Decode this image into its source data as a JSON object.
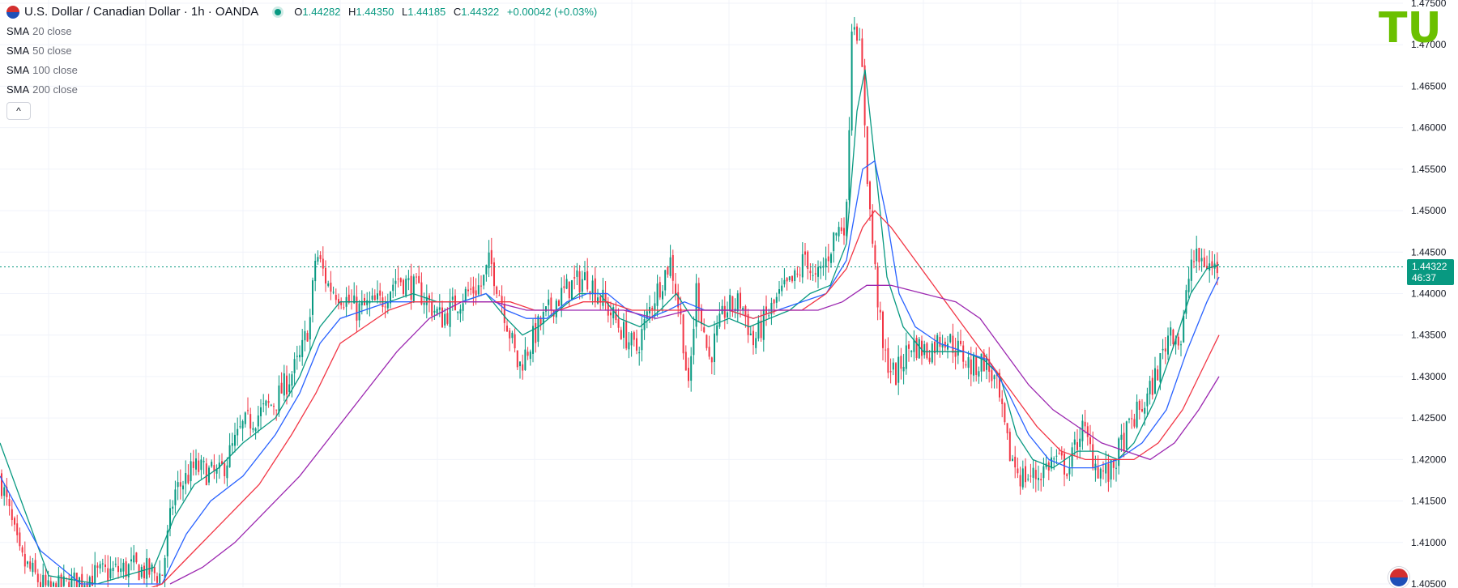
{
  "header": {
    "symbol_title": "U.S. Dollar / Canadian Dollar · 1h · OANDA",
    "ohlc": {
      "o_label": "O",
      "o_value": "1.44282",
      "h_label": "H",
      "h_value": "1.44350",
      "l_label": "L",
      "l_value": "1.44185",
      "c_label": "C",
      "c_value": "1.44322",
      "change": "+0.00042 (+0.03%)"
    }
  },
  "indicators": [
    {
      "name": "SMA",
      "params": "20 close",
      "color": "#089981"
    },
    {
      "name": "SMA",
      "params": "50 close",
      "color": "#2962ff"
    },
    {
      "name": "SMA",
      "params": "100 close",
      "color": "#f23645"
    },
    {
      "name": "SMA",
      "params": "200 close",
      "color": "#9c27b0"
    }
  ],
  "collapse_label": "^",
  "price_tag": {
    "price": "1.44322",
    "countdown": "46:37"
  },
  "logo_text": "TU",
  "colors": {
    "up": "#089981",
    "down": "#f23645",
    "grid": "#f0f3fa",
    "axis_text": "#131722",
    "logo": "#6bc000"
  },
  "chart_data": {
    "type": "candlestick",
    "ylim": [
      1.405,
      1.475
    ],
    "y_ticks": [
      "1.47500",
      "1.47000",
      "1.46500",
      "1.46000",
      "1.45500",
      "1.45000",
      "1.44500",
      "1.44000",
      "1.43500",
      "1.43000",
      "1.42500",
      "1.42000",
      "1.41500",
      "1.41000",
      "1.40500"
    ],
    "last_price": 1.44322,
    "close_path": [
      [
        0,
        1.418
      ],
      [
        25,
        1.408
      ],
      [
        60,
        1.404
      ],
      [
        115,
        1.406
      ],
      [
        165,
        1.407
      ],
      [
        200,
        1.406
      ],
      [
        215,
        1.416
      ],
      [
        240,
        1.419
      ],
      [
        270,
        1.418
      ],
      [
        300,
        1.424
      ],
      [
        340,
        1.427
      ],
      [
        370,
        1.432
      ],
      [
        383,
        1.437
      ],
      [
        390,
        1.445
      ],
      [
        405,
        1.441
      ],
      [
        420,
        1.44
      ],
      [
        440,
        1.438
      ],
      [
        470,
        1.439
      ],
      [
        490,
        1.442
      ],
      [
        520,
        1.44
      ],
      [
        545,
        1.437
      ],
      [
        575,
        1.44
      ],
      [
        595,
        1.441
      ],
      [
        605,
        1.444
      ],
      [
        620,
        1.439
      ],
      [
        640,
        1.431
      ],
      [
        665,
        1.436
      ],
      [
        685,
        1.439
      ],
      [
        705,
        1.441
      ],
      [
        725,
        1.442
      ],
      [
        745,
        1.439
      ],
      [
        765,
        1.436
      ],
      [
        785,
        1.433
      ],
      [
        805,
        1.439
      ],
      [
        828,
        1.444
      ],
      [
        842,
        1.436
      ],
      [
        850,
        1.428
      ],
      [
        860,
        1.441
      ],
      [
        875,
        1.432
      ],
      [
        895,
        1.438
      ],
      [
        915,
        1.439
      ],
      [
        930,
        1.434
      ],
      [
        945,
        1.437
      ],
      [
        965,
        1.44
      ],
      [
        985,
        1.442
      ],
      [
        995,
        1.445
      ],
      [
        1005,
        1.441
      ],
      [
        1020,
        1.444
      ],
      [
        1030,
        1.447
      ],
      [
        1045,
        1.449
      ],
      [
        1052,
        1.474
      ],
      [
        1058,
        1.472
      ],
      [
        1065,
        1.466
      ],
      [
        1072,
        1.452
      ],
      [
        1080,
        1.443
      ],
      [
        1090,
        1.433
      ],
      [
        1105,
        1.43
      ],
      [
        1125,
        1.434
      ],
      [
        1145,
        1.433
      ],
      [
        1165,
        1.435
      ],
      [
        1185,
        1.433
      ],
      [
        1200,
        1.431
      ],
      [
        1215,
        1.432
      ],
      [
        1230,
        1.429
      ],
      [
        1245,
        1.421
      ],
      [
        1260,
        1.418
      ],
      [
        1280,
        1.418
      ],
      [
        1300,
        1.42
      ],
      [
        1320,
        1.419
      ],
      [
        1335,
        1.424
      ],
      [
        1355,
        1.419
      ],
      [
        1370,
        1.418
      ],
      [
        1385,
        1.422
      ],
      [
        1400,
        1.425
      ],
      [
        1415,
        1.427
      ],
      [
        1430,
        1.431
      ],
      [
        1445,
        1.436
      ],
      [
        1458,
        1.434
      ],
      [
        1470,
        1.444
      ],
      [
        1485,
        1.444
      ],
      [
        1498,
        1.443
      ],
      [
        1505,
        1.4432
      ]
    ],
    "series": [
      {
        "indicator": "SMA 20 close",
        "points": [
          [
            0,
            1.422
          ],
          [
            60,
            1.406
          ],
          [
            120,
            1.405
          ],
          [
            190,
            1.407
          ],
          [
            215,
            1.413
          ],
          [
            240,
            1.417
          ],
          [
            270,
            1.419
          ],
          [
            300,
            1.422
          ],
          [
            340,
            1.425
          ],
          [
            370,
            1.43
          ],
          [
            395,
            1.436
          ],
          [
            420,
            1.439
          ],
          [
            450,
            1.439
          ],
          [
            480,
            1.439
          ],
          [
            510,
            1.44
          ],
          [
            540,
            1.439
          ],
          [
            570,
            1.439
          ],
          [
            600,
            1.44
          ],
          [
            625,
            1.437
          ],
          [
            645,
            1.435
          ],
          [
            665,
            1.436
          ],
          [
            690,
            1.438
          ],
          [
            715,
            1.44
          ],
          [
            740,
            1.44
          ],
          [
            765,
            1.437
          ],
          [
            790,
            1.436
          ],
          [
            815,
            1.438
          ],
          [
            835,
            1.44
          ],
          [
            855,
            1.437
          ],
          [
            875,
            1.436
          ],
          [
            900,
            1.437
          ],
          [
            925,
            1.436
          ],
          [
            950,
            1.437
          ],
          [
            975,
            1.438
          ],
          [
            1000,
            1.44
          ],
          [
            1025,
            1.441
          ],
          [
            1045,
            1.446
          ],
          [
            1058,
            1.462
          ],
          [
            1068,
            1.467
          ],
          [
            1080,
            1.456
          ],
          [
            1095,
            1.442
          ],
          [
            1115,
            1.436
          ],
          [
            1140,
            1.433
          ],
          [
            1165,
            1.433
          ],
          [
            1190,
            1.433
          ],
          [
            1215,
            1.432
          ],
          [
            1235,
            1.43
          ],
          [
            1255,
            1.423
          ],
          [
            1275,
            1.42
          ],
          [
            1300,
            1.419
          ],
          [
            1330,
            1.421
          ],
          [
            1355,
            1.421
          ],
          [
            1380,
            1.42
          ],
          [
            1400,
            1.422
          ],
          [
            1425,
            1.427
          ],
          [
            1450,
            1.434
          ],
          [
            1470,
            1.44
          ],
          [
            1490,
            1.443
          ],
          [
            1505,
            1.4435
          ]
        ]
      },
      {
        "indicator": "SMA 50 close",
        "points": [
          [
            0,
            1.418
          ],
          [
            50,
            1.409
          ],
          [
            100,
            1.405
          ],
          [
            160,
            1.405
          ],
          [
            200,
            1.405
          ],
          [
            230,
            1.411
          ],
          [
            260,
            1.415
          ],
          [
            300,
            1.418
          ],
          [
            340,
            1.423
          ],
          [
            370,
            1.428
          ],
          [
            395,
            1.434
          ],
          [
            420,
            1.437
          ],
          [
            450,
            1.438
          ],
          [
            480,
            1.439
          ],
          [
            510,
            1.439
          ],
          [
            540,
            1.439
          ],
          [
            570,
            1.439
          ],
          [
            600,
            1.44
          ],
          [
            625,
            1.438
          ],
          [
            650,
            1.437
          ],
          [
            675,
            1.437
          ],
          [
            700,
            1.439
          ],
          [
            725,
            1.44
          ],
          [
            750,
            1.44
          ],
          [
            775,
            1.438
          ],
          [
            800,
            1.437
          ],
          [
            825,
            1.438
          ],
          [
            845,
            1.439
          ],
          [
            870,
            1.438
          ],
          [
            900,
            1.438
          ],
          [
            930,
            1.437
          ],
          [
            960,
            1.438
          ],
          [
            990,
            1.439
          ],
          [
            1020,
            1.44
          ],
          [
            1045,
            1.444
          ],
          [
            1065,
            1.455
          ],
          [
            1080,
            1.456
          ],
          [
            1095,
            1.449
          ],
          [
            1110,
            1.44
          ],
          [
            1130,
            1.436
          ],
          [
            1160,
            1.434
          ],
          [
            1190,
            1.433
          ],
          [
            1220,
            1.432
          ],
          [
            1245,
            1.428
          ],
          [
            1270,
            1.423
          ],
          [
            1295,
            1.42
          ],
          [
            1320,
            1.419
          ],
          [
            1350,
            1.419
          ],
          [
            1380,
            1.42
          ],
          [
            1410,
            1.422
          ],
          [
            1440,
            1.426
          ],
          [
            1465,
            1.433
          ],
          [
            1490,
            1.439
          ],
          [
            1505,
            1.442
          ]
        ]
      },
      {
        "indicator": "SMA 100 close",
        "points": [
          [
            170,
            1.404
          ],
          [
            200,
            1.405
          ],
          [
            240,
            1.409
          ],
          [
            280,
            1.413
          ],
          [
            320,
            1.417
          ],
          [
            360,
            1.423
          ],
          [
            390,
            1.428
          ],
          [
            420,
            1.434
          ],
          [
            450,
            1.436
          ],
          [
            480,
            1.438
          ],
          [
            510,
            1.439
          ],
          [
            540,
            1.439
          ],
          [
            570,
            1.439
          ],
          [
            600,
            1.439
          ],
          [
            630,
            1.439
          ],
          [
            660,
            1.438
          ],
          [
            690,
            1.438
          ],
          [
            720,
            1.439
          ],
          [
            750,
            1.439
          ],
          [
            780,
            1.438
          ],
          [
            810,
            1.438
          ],
          [
            840,
            1.438
          ],
          [
            870,
            1.438
          ],
          [
            900,
            1.438
          ],
          [
            930,
            1.437
          ],
          [
            960,
            1.438
          ],
          [
            990,
            1.438
          ],
          [
            1020,
            1.44
          ],
          [
            1045,
            1.443
          ],
          [
            1065,
            1.448
          ],
          [
            1080,
            1.45
          ],
          [
            1100,
            1.448
          ],
          [
            1130,
            1.444
          ],
          [
            1160,
            1.44
          ],
          [
            1190,
            1.436
          ],
          [
            1220,
            1.432
          ],
          [
            1250,
            1.428
          ],
          [
            1280,
            1.424
          ],
          [
            1310,
            1.421
          ],
          [
            1340,
            1.42
          ],
          [
            1370,
            1.42
          ],
          [
            1400,
            1.42
          ],
          [
            1430,
            1.422
          ],
          [
            1460,
            1.426
          ],
          [
            1490,
            1.432
          ],
          [
            1505,
            1.435
          ]
        ]
      },
      {
        "indicator": "SMA 200 close",
        "points": [
          [
            210,
            1.405
          ],
          [
            250,
            1.407
          ],
          [
            290,
            1.41
          ],
          [
            330,
            1.414
          ],
          [
            370,
            1.418
          ],
          [
            410,
            1.423
          ],
          [
            450,
            1.428
          ],
          [
            490,
            1.433
          ],
          [
            530,
            1.437
          ],
          [
            570,
            1.439
          ],
          [
            610,
            1.439
          ],
          [
            650,
            1.438
          ],
          [
            690,
            1.438
          ],
          [
            730,
            1.438
          ],
          [
            770,
            1.438
          ],
          [
            810,
            1.437
          ],
          [
            850,
            1.438
          ],
          [
            890,
            1.438
          ],
          [
            930,
            1.438
          ],
          [
            970,
            1.438
          ],
          [
            1010,
            1.438
          ],
          [
            1040,
            1.439
          ],
          [
            1070,
            1.441
          ],
          [
            1100,
            1.441
          ],
          [
            1140,
            1.44
          ],
          [
            1180,
            1.439
          ],
          [
            1210,
            1.437
          ],
          [
            1240,
            1.433
          ],
          [
            1270,
            1.429
          ],
          [
            1300,
            1.426
          ],
          [
            1330,
            1.424
          ],
          [
            1360,
            1.422
          ],
          [
            1390,
            1.421
          ],
          [
            1420,
            1.42
          ],
          [
            1450,
            1.422
          ],
          [
            1480,
            1.426
          ],
          [
            1505,
            1.43
          ]
        ]
      }
    ]
  }
}
